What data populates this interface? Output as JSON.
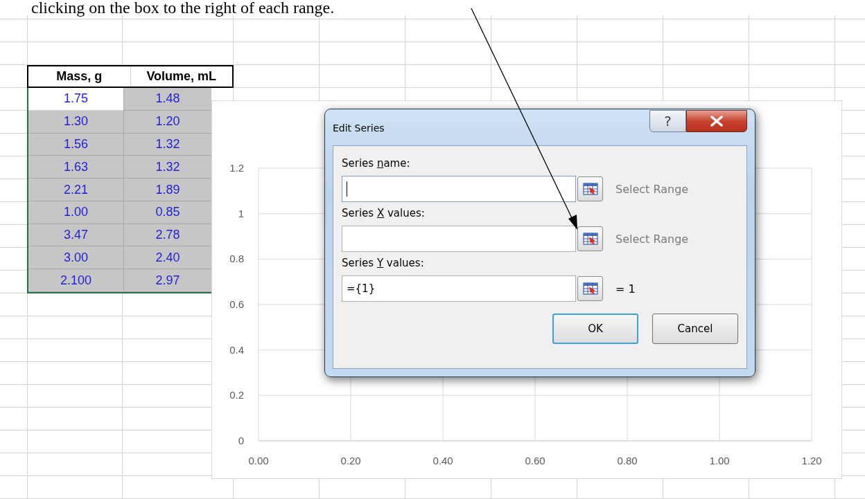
{
  "document_text": "clicking on the box to the right of each range.",
  "sheet": {
    "columns": [
      {
        "label": "Mass, g"
      },
      {
        "label": "Volume, mL"
      }
    ],
    "rows": [
      {
        "cells": [
          {
            "text": "1.75",
            "selected": false
          },
          {
            "text": "1.48",
            "selected": true
          }
        ]
      },
      {
        "cells": [
          {
            "text": "1.30",
            "selected": true
          },
          {
            "text": "1.20",
            "selected": true
          }
        ]
      },
      {
        "cells": [
          {
            "text": "1.56",
            "selected": true
          },
          {
            "text": "1.32",
            "selected": true
          }
        ]
      },
      {
        "cells": [
          {
            "text": "1.63",
            "selected": true
          },
          {
            "text": "1.32",
            "selected": true
          }
        ]
      },
      {
        "cells": [
          {
            "text": "2.21",
            "selected": true
          },
          {
            "text": "1.89",
            "selected": true
          }
        ]
      },
      {
        "cells": [
          {
            "text": "1.00",
            "selected": true
          },
          {
            "text": "0.85",
            "selected": true
          }
        ]
      },
      {
        "cells": [
          {
            "text": "3.47",
            "selected": true
          },
          {
            "text": "2.78",
            "selected": true
          }
        ]
      },
      {
        "cells": [
          {
            "text": "3.00",
            "selected": true
          },
          {
            "text": "2.40",
            "selected": true
          }
        ]
      },
      {
        "cells": [
          {
            "text": "2.100",
            "selected": true
          },
          {
            "text": "2.97",
            "selected": true
          }
        ]
      }
    ]
  },
  "chart": {
    "chart_data": {
      "type": "scatter",
      "grid": true,
      "xlim": [
        0,
        1.2
      ],
      "ylim": [
        0,
        1.2
      ],
      "xticks": [
        {
          "value": 0,
          "label": "0.00"
        },
        {
          "value": 0.2,
          "label": "0.20"
        },
        {
          "value": 0.4,
          "label": "0.40"
        },
        {
          "value": 0.6,
          "label": "0.60"
        },
        {
          "value": 0.8,
          "label": "0.80"
        },
        {
          "value": 1,
          "label": "1.00"
        },
        {
          "value": 1.2,
          "label": "1.20"
        }
      ],
      "yticks": [
        {
          "value": 0,
          "label": "0"
        },
        {
          "value": 0.2,
          "label": "0.2"
        },
        {
          "value": 0.4,
          "label": "0.4"
        },
        {
          "value": 0.6,
          "label": "0.6"
        },
        {
          "value": 0.8,
          "label": "0.8"
        },
        {
          "value": 1,
          "label": "1"
        },
        {
          "value": 1.2,
          "label": "1.2"
        }
      ]
    }
  },
  "dialog": {
    "title": "Edit Series",
    "help_button": "?",
    "fields": [
      {
        "label": [
          "Series ",
          "n",
          "ame:"
        ],
        "focused": true,
        "note": "Select Range",
        "note_muted": true
      },
      {
        "label": [
          "Series ",
          "X",
          " values:"
        ],
        "focused": false,
        "note": "Select Range",
        "note_muted": true
      },
      {
        "label": [
          "Series ",
          "Y",
          " values:"
        ],
        "value": "={1}",
        "focused": false,
        "note": "= 1",
        "note_muted": false
      }
    ],
    "buttons": [
      {
        "label": "OK",
        "default": true
      },
      {
        "label": "Cancel",
        "default": false
      }
    ]
  }
}
